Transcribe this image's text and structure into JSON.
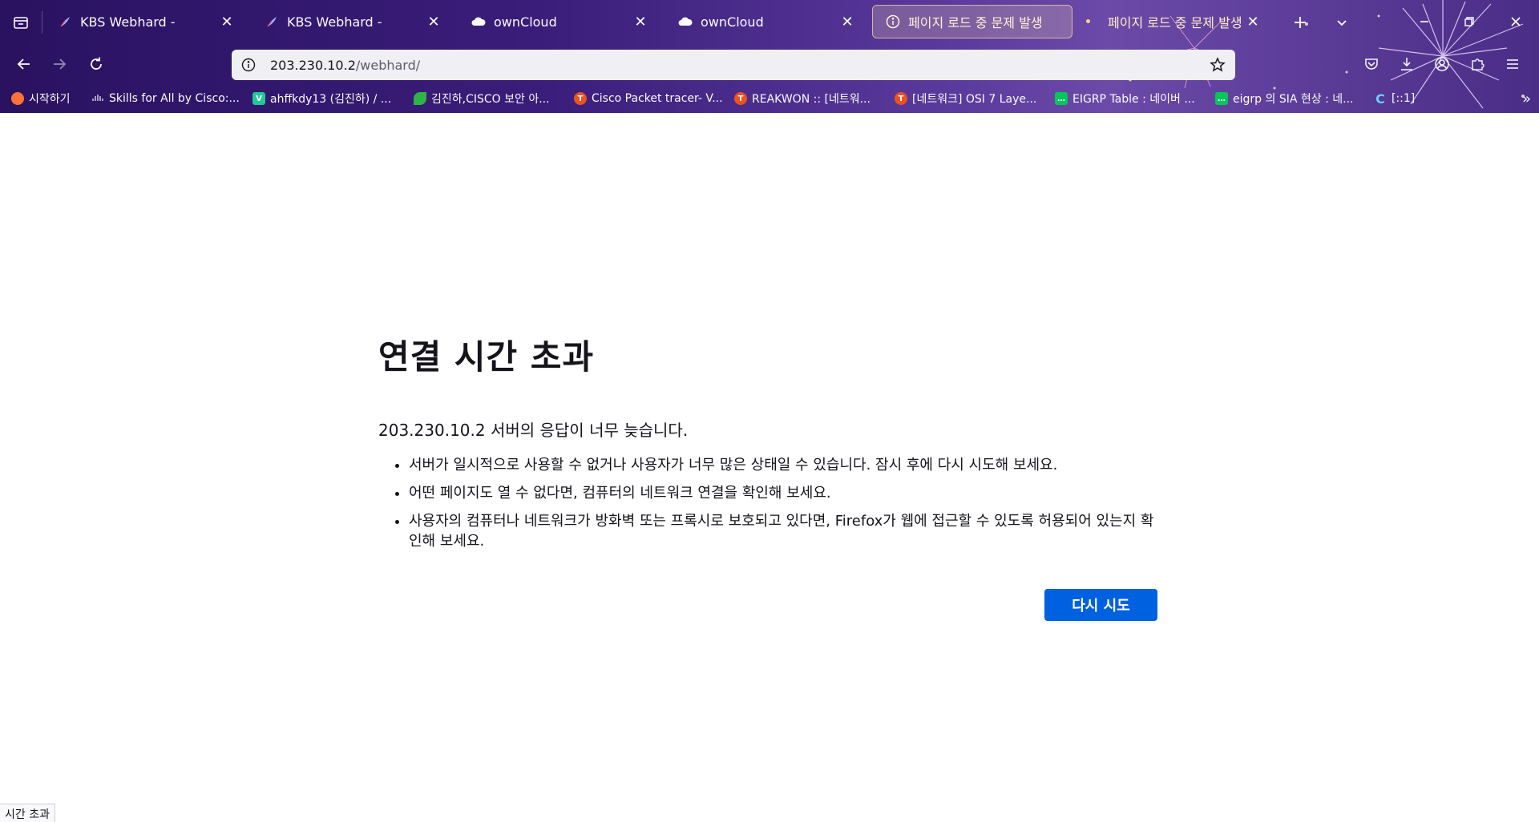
{
  "browser": {
    "tabs": [
      {
        "label": "KBS Webhard -",
        "favicon": "feather-icon",
        "active": false
      },
      {
        "label": "KBS Webhard -",
        "favicon": "feather-icon",
        "active": false
      },
      {
        "label": "ownCloud",
        "favicon": "cloud-icon",
        "active": false
      },
      {
        "label": "ownCloud",
        "favicon": "cloud-icon",
        "active": false
      },
      {
        "label": "페이지 로드 중 문제 발생",
        "favicon": "info-icon",
        "active": true
      },
      {
        "label": "페이지 로드 중 문제 발생",
        "favicon": "none",
        "active": false
      }
    ],
    "new_tab_label": "+",
    "url_host": "203.230.10.2",
    "url_path": "/webhard/",
    "bookmarks": [
      {
        "label": "시작하기",
        "favicon": "firefox-icon"
      },
      {
        "label": "Skills for All by Cisco:...",
        "favicon": "cisco-icon"
      },
      {
        "label": "ahffkdy13 (김진하) / ...",
        "favicon": "velog-icon"
      },
      {
        "label": "김진하,CISCO 보안 아...",
        "favicon": "leaf-icon"
      },
      {
        "label": "Cisco Packet tracer- V...",
        "favicon": "tistory-icon"
      },
      {
        "label": "REAKWON :: [네트워...",
        "favicon": "tistory-icon"
      },
      {
        "label": "[네트워크] OSI 7 Laye...",
        "favicon": "tistory-icon"
      },
      {
        "label": "EIGRP Table : 네이버 ...",
        "favicon": "naver-blog-icon"
      },
      {
        "label": "eigrp 의 SIA 현상 : 네...",
        "favicon": "naver-blog-icon"
      },
      {
        "label": "[::1]",
        "favicon": "c-icon"
      }
    ]
  },
  "error_page": {
    "title": "연결 시간 초과",
    "description": "203.230.10.2 서버의 응답이 너무 늦습니다.",
    "suggestions": [
      "서버가 일시적으로 사용할 수 없거나 사용자가 너무 많은 상태일 수 있습니다. 잠시 후에 다시 시도해 보세요.",
      "어떤 페이지도 열 수 없다면, 컴퓨터의 네트워크 연결을 확인해 보세요.",
      "사용자의 컴퓨터나 네트워크가 방화벽 또는 프록시로 보호되고 있다면, Firefox가 웹에 접근할 수 있도록 허용되어 있는지 확인해 보세요."
    ],
    "retry_label": "다시 시도"
  },
  "status_text": "시간 초과",
  "colors": {
    "primary_button": "#0061e0",
    "url_bar_bg": "#f0f0f4",
    "page_text": "#15141a"
  }
}
